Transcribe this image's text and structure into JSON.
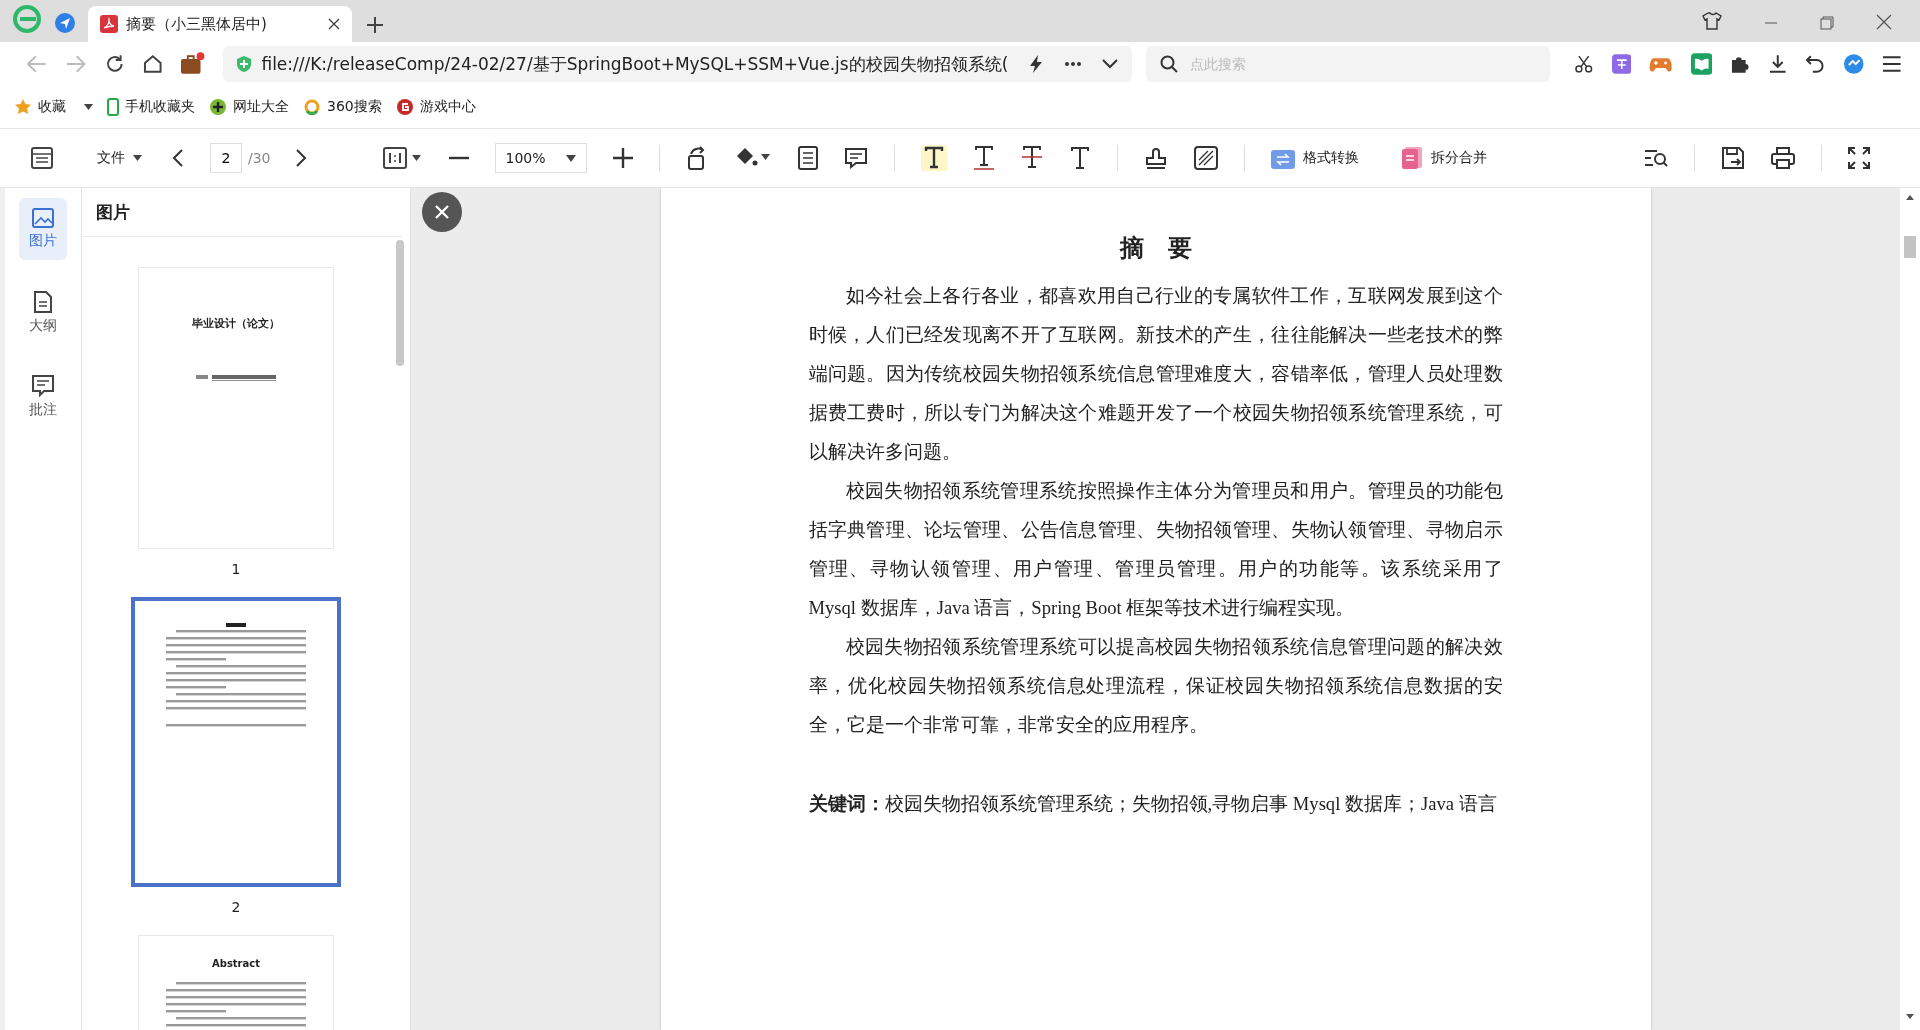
{
  "browser": {
    "tabs": [
      {
        "title": "摘要（小三黑体居中)",
        "selected": true
      }
    ],
    "address": "file:///K:/releaseComp/24-02/27/基于SpringBoot+MySQL+SSM+Vue.js的校园失物招领系统(",
    "search": {
      "placeholder": "点此搜索"
    },
    "bookmarks": [
      "收藏",
      "手机收藏夹",
      "网址大全",
      "360搜索",
      "游戏中心"
    ]
  },
  "toolbar": {
    "file_menu": "文件",
    "page": "2",
    "page_total": "/30",
    "zoom": "100%",
    "format_convert": "格式转换",
    "split_merge": "拆分合并"
  },
  "sidebar": {
    "rail": [
      {
        "label": "图片",
        "selected": true
      },
      {
        "label": "大纲",
        "selected": false
      },
      {
        "label": "批注",
        "selected": false
      }
    ],
    "panel_title": "图片",
    "thumbnails": [
      {
        "heading": "毕业设计（论文）",
        "number": "1",
        "selected": false
      },
      {
        "number": "2",
        "selected": true
      },
      {
        "heading": "Abstract",
        "selected": false
      }
    ]
  },
  "document": {
    "title": "摘要",
    "paragraphs": [
      "如今社会上各行各业，都喜欢用自己行业的专属软件工作，互联网发展到这个时候，人们已经发现离不开了互联网。新技术的产生，往往能解决一些老技术的弊端问题。因为传统校园失物招领系统信息管理难度大，容错率低，管理人员处理数据费工费时，所以专门为解决这个难题开发了一个校园失物招领系统管理系统，可以解决许多问题。",
      "校园失物招领系统管理系统按照操作主体分为管理员和用户。管理员的功能包括字典管理、论坛管理、公告信息管理、失物招领管理、失物认领管理、寻物启示管理、寻物认领管理、用户管理、管理员管理。用户的功能等。该系统采用了 Mysql 数据库，Java 语言，Spring Boot 框架等技术进行编程实现。",
      "校园失物招领系统管理系统可以提高校园失物招领系统信息管理问题的解决效率，优化校园失物招领系统信息处理流程，保证校园失物招领系统信息数据的安全，它是一个非常可靠，非常安全的应用程序。"
    ],
    "keywords": "**关键词：**校园失物招领系统管理系统；失物招领,寻物启事 Mysql 数据库；Java 语言"
  }
}
